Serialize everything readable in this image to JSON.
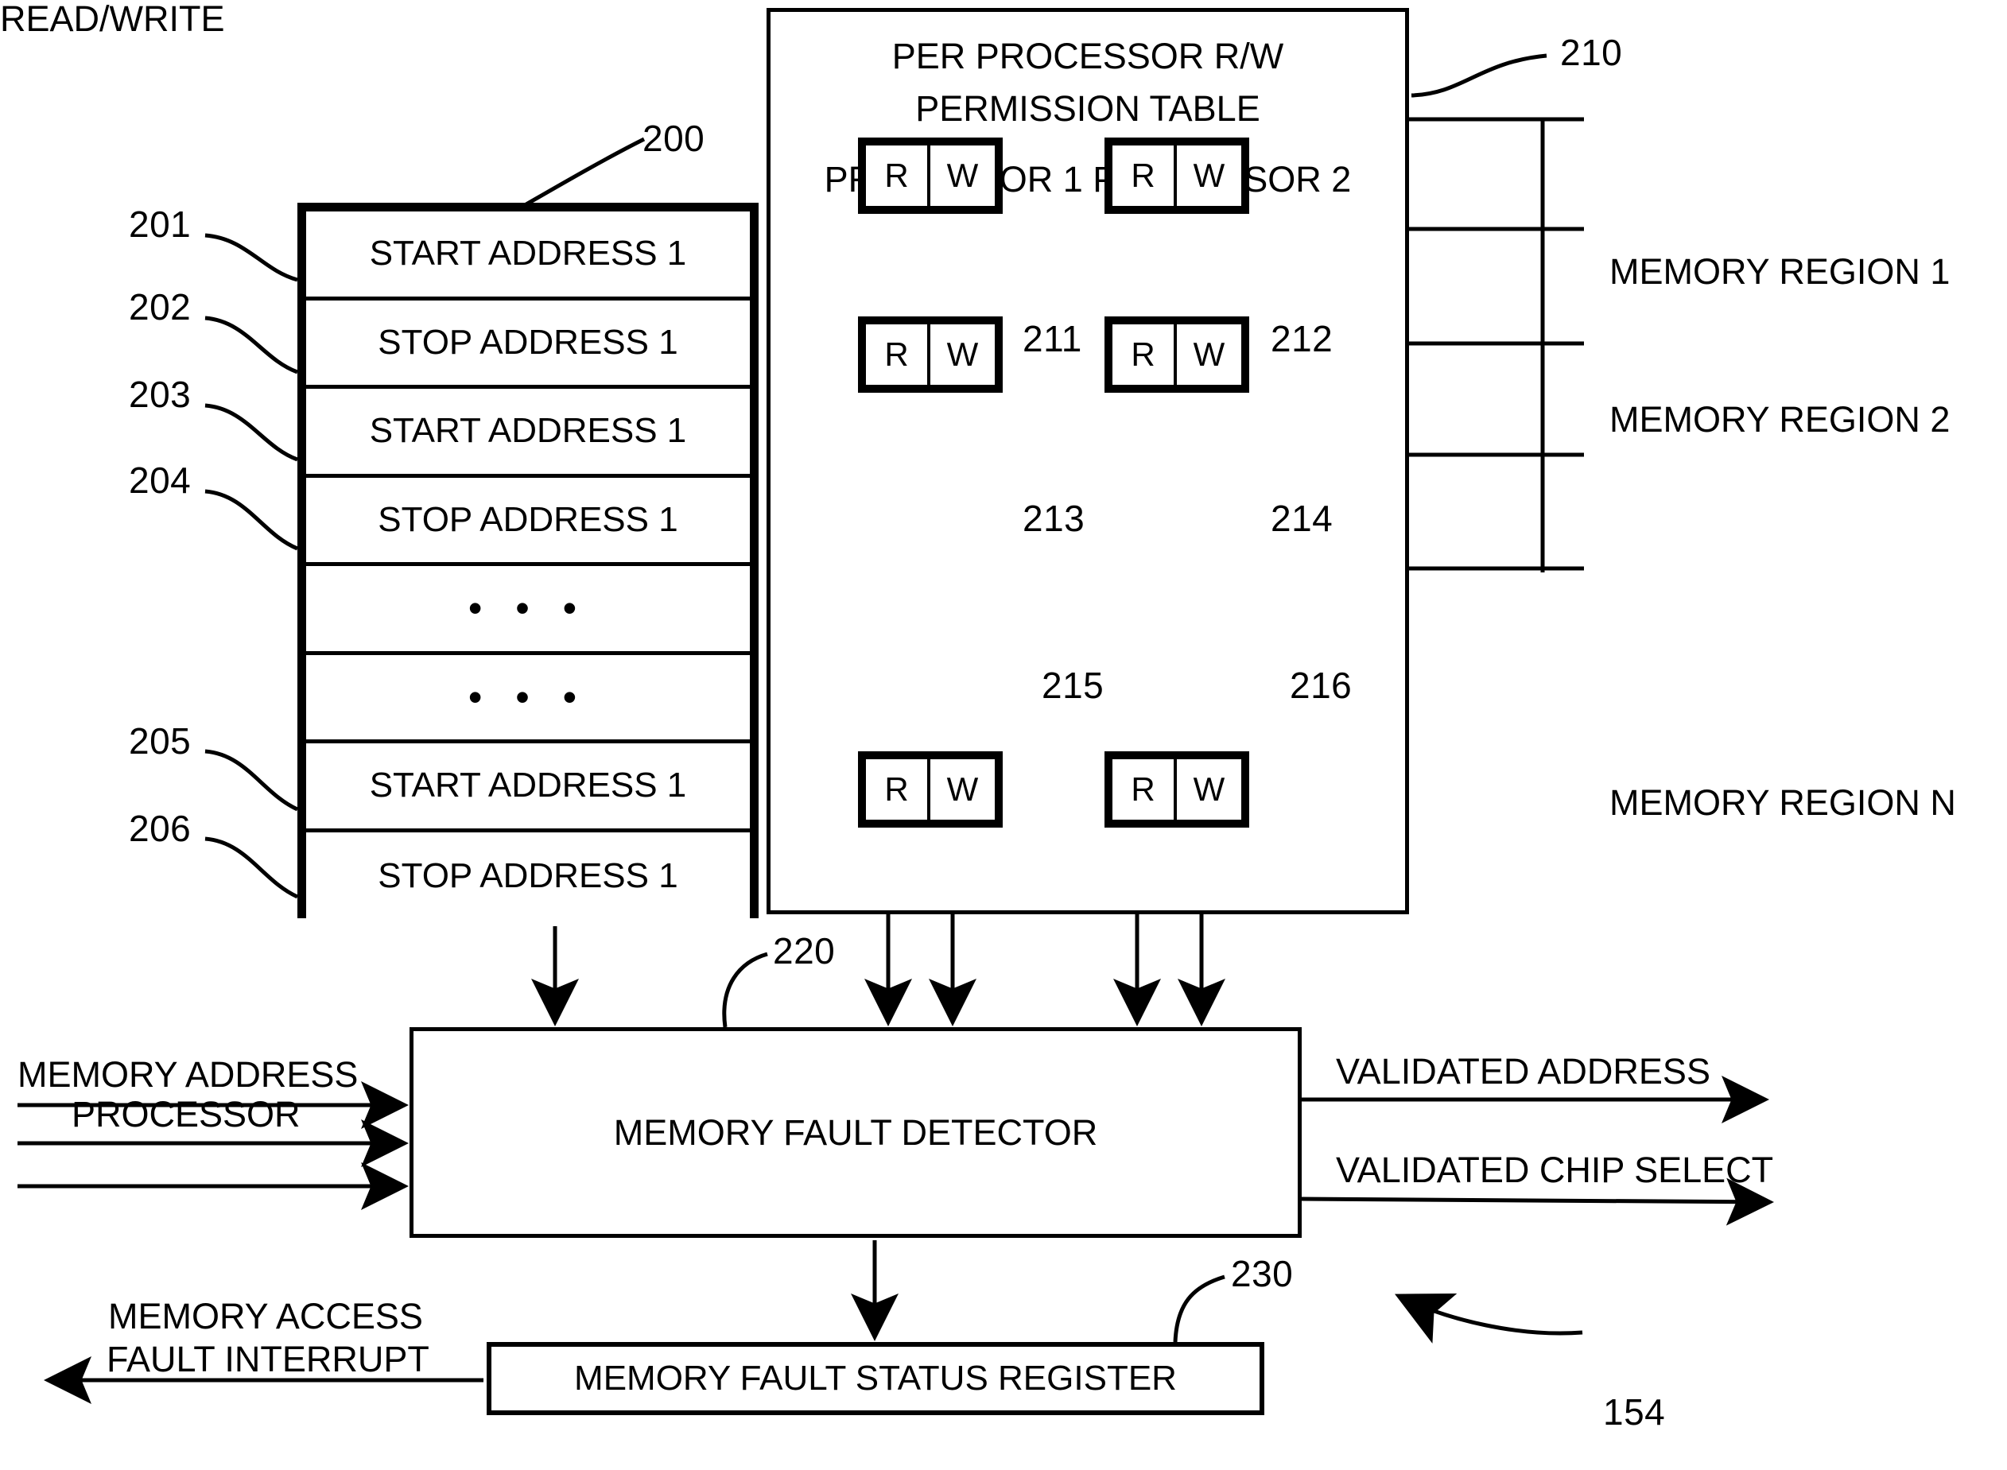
{
  "figure": {
    "ref_154": "154"
  },
  "address_table": {
    "ref": "200",
    "rows": [
      {
        "ref": "201",
        "label": "START ADDRESS 1",
        "kind": "text"
      },
      {
        "ref": "202",
        "label": "STOP ADDRESS 1",
        "kind": "text"
      },
      {
        "ref": "203",
        "label": "START ADDRESS 1",
        "kind": "text"
      },
      {
        "ref": "204",
        "label": "STOP ADDRESS 1",
        "kind": "text"
      },
      {
        "ref": "",
        "label": "• • •",
        "kind": "dots"
      },
      {
        "ref": "",
        "label": "• • •",
        "kind": "dots"
      },
      {
        "ref": "205",
        "label": "START ADDRESS 1",
        "kind": "text"
      },
      {
        "ref": "206",
        "label": "STOP ADDRESS 1",
        "kind": "text"
      }
    ]
  },
  "permission_table": {
    "ref": "210",
    "title_line1": "PER PROCESSOR R/W",
    "title_line2": "PERMISSION TABLE",
    "columns": [
      "PROCESSOR 1",
      "PROCESSOR 2"
    ],
    "column_header_combined": "PROCESSOR 1 PROCESSOR 2",
    "permission_letters": {
      "read": "R",
      "write": "W"
    },
    "cells": [
      {
        "ref": "211",
        "processor": "PROCESSOR 1",
        "region": "MEMORY REGION 1",
        "read": "R",
        "write": "W"
      },
      {
        "ref": "212",
        "processor": "PROCESSOR 2",
        "region": "MEMORY REGION 1",
        "read": "R",
        "write": "W"
      },
      {
        "ref": "213",
        "processor": "PROCESSOR 1",
        "region": "MEMORY REGION 2",
        "read": "R",
        "write": "W"
      },
      {
        "ref": "214",
        "processor": "PROCESSOR 2",
        "region": "MEMORY REGION 2",
        "read": "R",
        "write": "W"
      },
      {
        "ref": "215",
        "processor": "PROCESSOR 1",
        "region": "MEMORY REGION N",
        "read": "R",
        "write": "W"
      },
      {
        "ref": "216",
        "processor": "PROCESSOR 2",
        "region": "MEMORY REGION N",
        "read": "R",
        "write": "W"
      }
    ]
  },
  "memory_regions": [
    {
      "label": "MEMORY REGION 1"
    },
    {
      "label": "MEMORY REGION 2"
    },
    {
      "label": "MEMORY REGION N"
    }
  ],
  "detector": {
    "ref": "220",
    "label": "MEMORY FAULT DETECTOR",
    "inputs": [
      {
        "label": "MEMORY ADDRESS"
      },
      {
        "label": "PROCESSOR"
      },
      {
        "label": "READ/WRITE"
      }
    ],
    "outputs": [
      {
        "label": "VALIDATED ADDRESS"
      },
      {
        "label": "VALIDATED CHIP SELECT"
      }
    ]
  },
  "status_register": {
    "ref": "230",
    "label": "MEMORY FAULT STATUS REGISTER",
    "interrupt_line1": "MEMORY ACCESS",
    "interrupt_line2": "FAULT INTERRUPT"
  },
  "colors": {
    "ink": "#000000",
    "paper": "#ffffff"
  }
}
